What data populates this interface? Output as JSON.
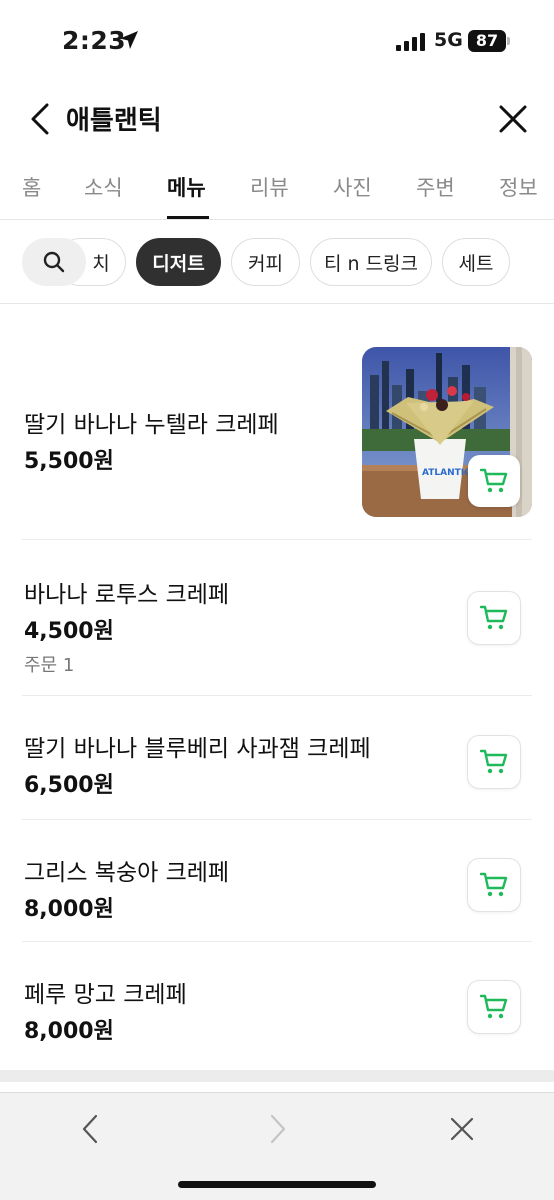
{
  "status_bar": {
    "time": "2:23",
    "network": "5G",
    "battery": "87"
  },
  "header": {
    "title": "애틀랜틱"
  },
  "tabs": [
    {
      "label": "홈"
    },
    {
      "label": "소식"
    },
    {
      "label": "메뉴"
    },
    {
      "label": "리뷰"
    },
    {
      "label": "사진"
    },
    {
      "label": "주변"
    },
    {
      "label": "정보"
    }
  ],
  "active_tab": "메뉴",
  "categories": [
    {
      "label": "치"
    },
    {
      "label": "디저트"
    },
    {
      "label": "커피"
    },
    {
      "label": "티 n 드링크"
    },
    {
      "label": "세트"
    }
  ],
  "active_category": "디저트",
  "menu_items": [
    {
      "name": "딸기 바나나 누텔라 크레페",
      "price": "5,500원",
      "image": "crepe-cup-photo",
      "image_caption": "ATLANTIC"
    },
    {
      "name": "바나나 로투스 크레페",
      "price": "4,500원",
      "order": "주문 1"
    },
    {
      "name": "딸기 바나나 블루베리 사과잼 크레페",
      "price": "6,500원"
    },
    {
      "name": "그리스 복숭아 크레페",
      "price": "8,000원"
    },
    {
      "name": "페루 망고 크레페",
      "price": "8,000원"
    }
  ],
  "colors": {
    "accent_green": "#1fb95a",
    "chip_active_bg": "#303030",
    "text_primary": "#111111",
    "text_muted": "#8a8a8a"
  },
  "icons": [
    "location-arrow-icon",
    "signal-icon",
    "back-icon",
    "close-icon",
    "search-icon",
    "cart-icon",
    "chevron-left-icon",
    "chevron-right-icon"
  ]
}
